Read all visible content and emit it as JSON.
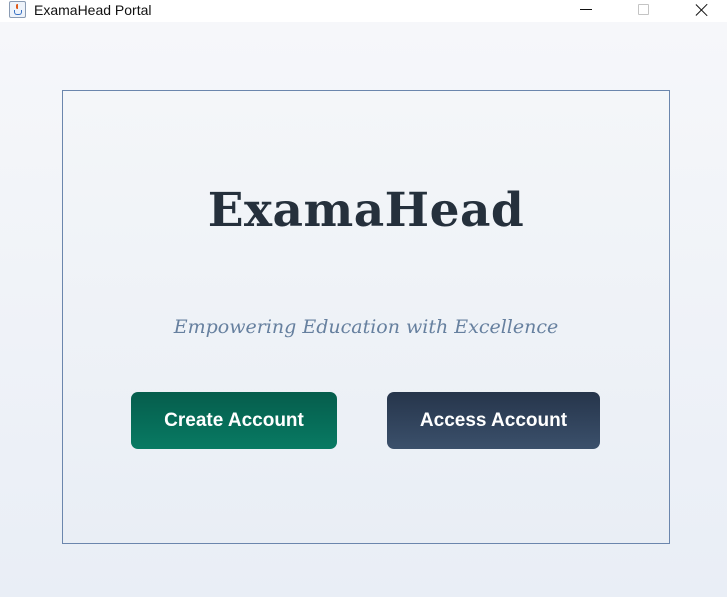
{
  "window": {
    "title": "ExamaHead Portal",
    "icon": "java-cup-icon",
    "controls": [
      "minimize-icon",
      "maximize-icon",
      "close-icon"
    ]
  },
  "card": {
    "title": "ExamaHead",
    "tagline": "Empowering Education with Excellence"
  },
  "buttons": {
    "create_label": "Create Account",
    "access_label": "Access Account"
  },
  "colors": {
    "create_button": "#06735d",
    "access_button": "#2f4159",
    "title_text": "#25303c",
    "tagline_text": "#66809f",
    "card_border": "#6b86ad"
  }
}
